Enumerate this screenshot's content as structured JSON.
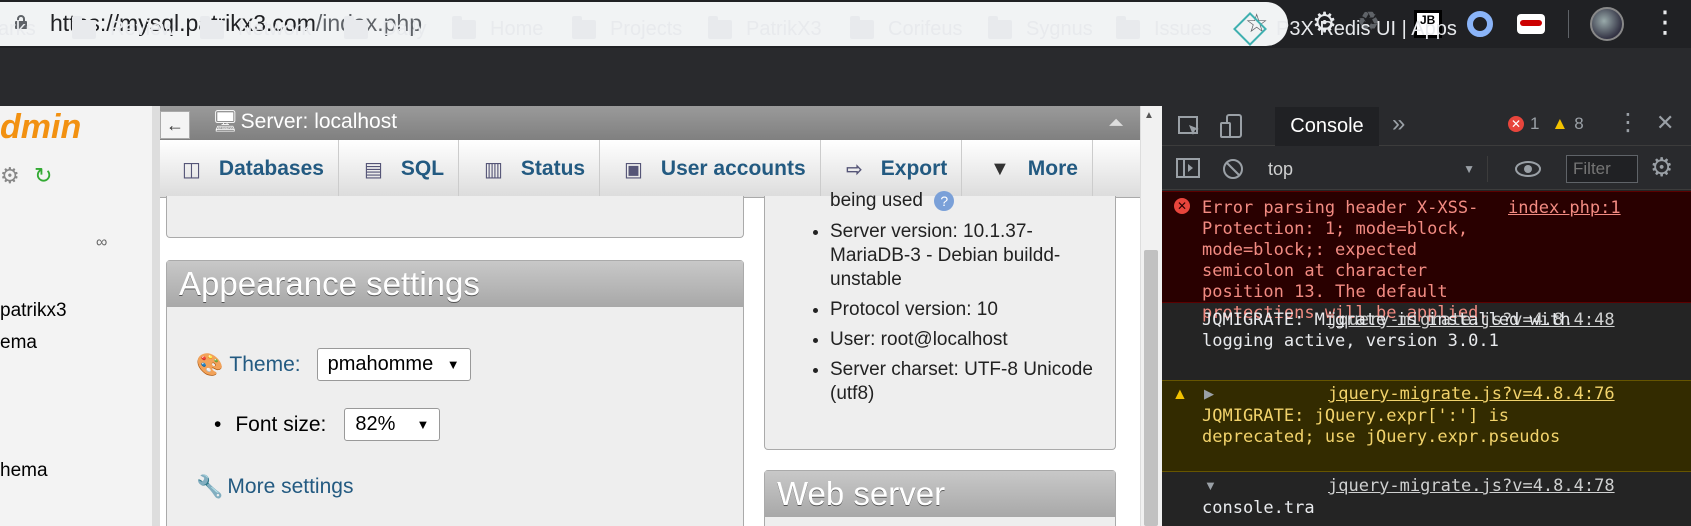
{
  "browser": {
    "url_host": "https://mysql.patrikx3.com",
    "url_path": "/index.php",
    "extensions": [
      "gear-icon",
      "recycle-icon",
      "jetbrains-icon",
      "ring-icon",
      "mask-icon"
    ],
    "bookmarks": [
      {
        "label": "arks"
      },
      {
        "label": "Review"
      },
      {
        "label": "Network"
      },
      {
        "label": "Daily"
      },
      {
        "label": "Home"
      },
      {
        "label": "Projects"
      },
      {
        "label": "PatrikX3"
      },
      {
        "label": "Corifeus"
      },
      {
        "label": "Sygnus"
      },
      {
        "label": "Issues"
      },
      {
        "label": "P3X Redis UI | Apps"
      }
    ]
  },
  "pma": {
    "logo": "dmin",
    "sidebar_items": [
      "patrikx3",
      "ema",
      "hema"
    ],
    "server_title": "Server: localhost",
    "back_label": "←",
    "tabs": [
      {
        "label": "Databases"
      },
      {
        "label": "SQL"
      },
      {
        "label": "Status"
      },
      {
        "label": "User accounts"
      },
      {
        "label": "Export"
      },
      {
        "label": "More"
      }
    ],
    "appearance": {
      "title": "Appearance settings",
      "theme_label": "Theme:",
      "theme_value": "pmahomme",
      "font_label": "Font size:",
      "font_value": "82%",
      "more_settings": "More settings"
    },
    "server_info": {
      "partial_top": "being used",
      "items": [
        "Server version: 10.1.37-MariaDB-3 - Debian buildd-unstable",
        "Protocol version: 10",
        "User: root@localhost",
        "Server charset: UTF-8 Unicode (utf8)"
      ]
    },
    "web_server_title": "Web server"
  },
  "devtools": {
    "tab": "Console",
    "errors": "1",
    "warnings": "8",
    "context": "top",
    "filter_placeholder": "Filter",
    "messages": [
      {
        "type": "error",
        "source": "index.php:1",
        "text": "Error parsing header X-XSS-Protection: 1; mode=block, mode=block;: expected semicolon at character position 13. The default protections will be applied."
      },
      {
        "type": "log",
        "source": "jquery-migrate.js?v=4.8.4:48",
        "text": "JQMIGRATE: Migrate is installed with logging active, version 3.0.1"
      },
      {
        "type": "warning",
        "source": "jquery-migrate.js?v=4.8.4:76",
        "text": "JQMIGRATE: jQuery.expr[':'] is deprecated; use jQuery.expr.pseudos"
      },
      {
        "type": "log",
        "source": "jquery-migrate.js?v=4.8.4:78",
        "text": "console.tra"
      }
    ]
  },
  "colors": {
    "pma_orange": "#f29111",
    "pma_link": "#235a81",
    "error_bg": "#290000",
    "warn_bg": "#332b00"
  }
}
